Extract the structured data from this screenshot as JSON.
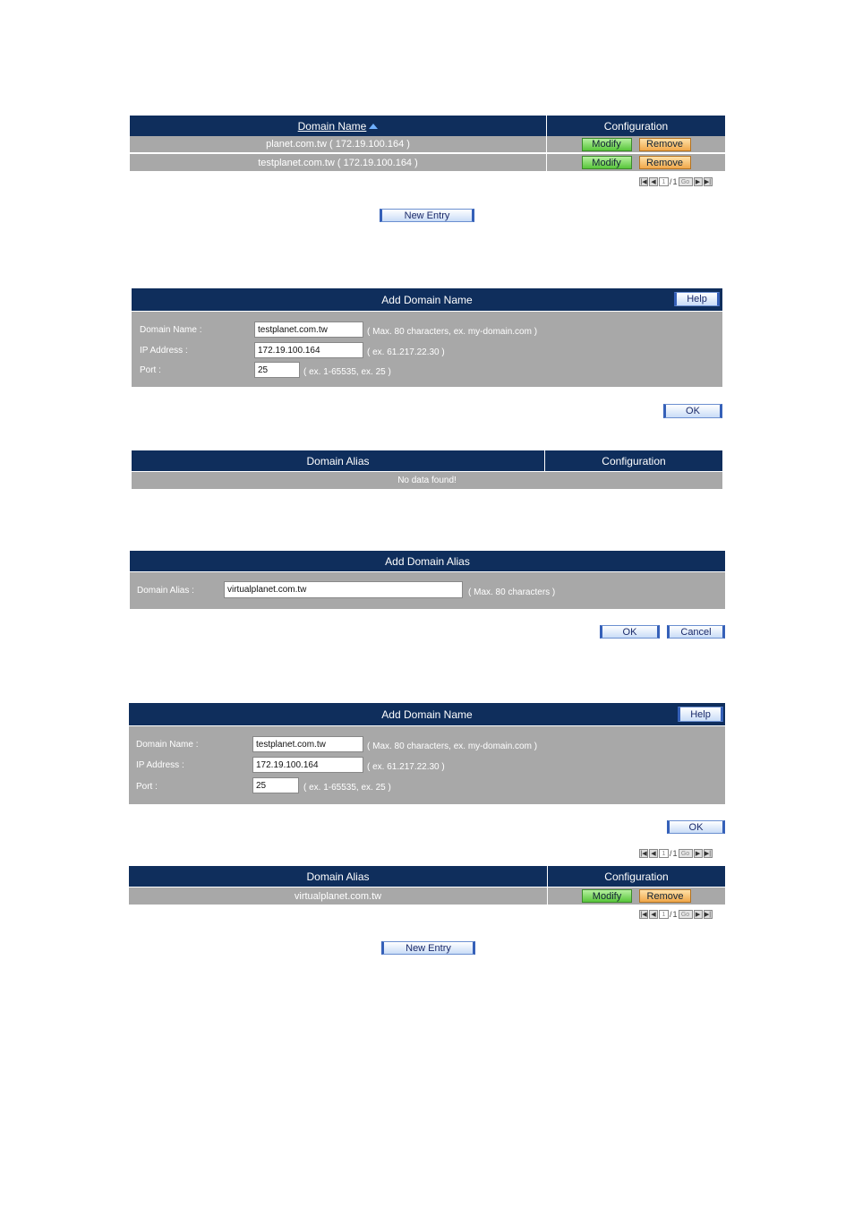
{
  "section1": {
    "headers": {
      "domain_name": "Domain Name",
      "sort_icon": "sort-ascending-icon",
      "configuration": "Configuration"
    },
    "rows": [
      {
        "domain": "planet.com.tw  ( 172.19.100.164 )",
        "modify": "Modify",
        "remove": "Remove"
      },
      {
        "domain": "testplanet.com.tw  ( 172.19.100.164 )",
        "modify": "Modify",
        "remove": "Remove"
      }
    ],
    "pager": {
      "page": "1",
      "sep": "/",
      "total": "1",
      "go": "Go"
    },
    "new_entry": "New Entry"
  },
  "section2": {
    "title": "Add Domain Name",
    "help": "Help",
    "fields": {
      "domain_label": "Domain Name :",
      "domain_value": "testplanet.com.tw",
      "domain_hint": "( Max. 80 characters, ex. my-domain.com )",
      "ip_label": "IP Address :",
      "ip_value": "172.19.100.164",
      "ip_hint": "( ex. 61.217.22.30 )",
      "port_label": "Port :",
      "port_value": "25",
      "port_hint": "( ex. 1-65535, ex. 25 )"
    },
    "ok": "OK"
  },
  "section3": {
    "headers": {
      "alias": "Domain Alias",
      "configuration": "Configuration"
    },
    "empty": "No data found!"
  },
  "section4": {
    "title": "Add Domain Alias",
    "label": "Domain Alias :",
    "value": "virtualplanet.com.tw",
    "hint": "( Max. 80 characters )",
    "ok": "OK",
    "cancel": "Cancel"
  },
  "section5": {
    "title": "Add Domain Name",
    "help": "Help",
    "fields": {
      "domain_label": "Domain Name :",
      "domain_value": "testplanet.com.tw",
      "domain_hint": "( Max. 80 characters, ex. my-domain.com )",
      "ip_label": "IP Address :",
      "ip_value": "172.19.100.164",
      "ip_hint": "( ex. 61.217.22.30 )",
      "port_label": "Port :",
      "port_value": "25",
      "port_hint": "( ex. 1-65535, ex. 25 )"
    },
    "ok": "OK",
    "pager": {
      "page": "1",
      "sep": "/",
      "total": "1",
      "go": "Go"
    },
    "alias_headers": {
      "alias": "Domain Alias",
      "configuration": "Configuration"
    },
    "alias_rows": [
      {
        "alias": "virtualplanet.com.tw",
        "modify": "Modify",
        "remove": "Remove"
      }
    ],
    "pager2": {
      "page": "1",
      "sep": "/",
      "total": "1",
      "go": "Go"
    },
    "new_entry": "New Entry"
  }
}
